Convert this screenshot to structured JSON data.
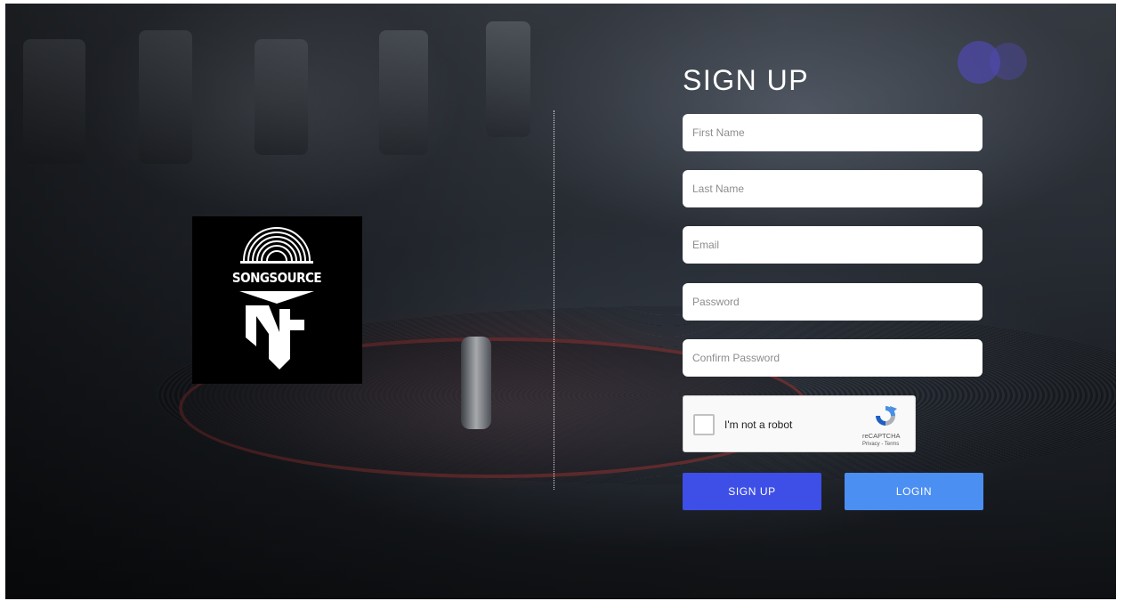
{
  "brand": {
    "name": "SONGSOURCE"
  },
  "form": {
    "title": "SIGN UP",
    "fields": [
      {
        "placeholder": "First Name",
        "value": ""
      },
      {
        "placeholder": "Last Name",
        "value": ""
      },
      {
        "placeholder": "Email",
        "value": ""
      },
      {
        "placeholder": "Password",
        "value": ""
      },
      {
        "placeholder": "Confirm Password",
        "value": ""
      }
    ],
    "captcha": {
      "label": "I'm not a robot",
      "brand": "reCAPTCHA",
      "links": "Privacy - Terms",
      "icon": "recaptcha-icon"
    },
    "buttons": {
      "signup": "SIGN UP",
      "login": "LOGIN"
    }
  },
  "colors": {
    "signup_button": "#3d4fe6",
    "login_button": "#4b8ff2",
    "title_text": "#ffffff",
    "logo_background": "#000000"
  }
}
